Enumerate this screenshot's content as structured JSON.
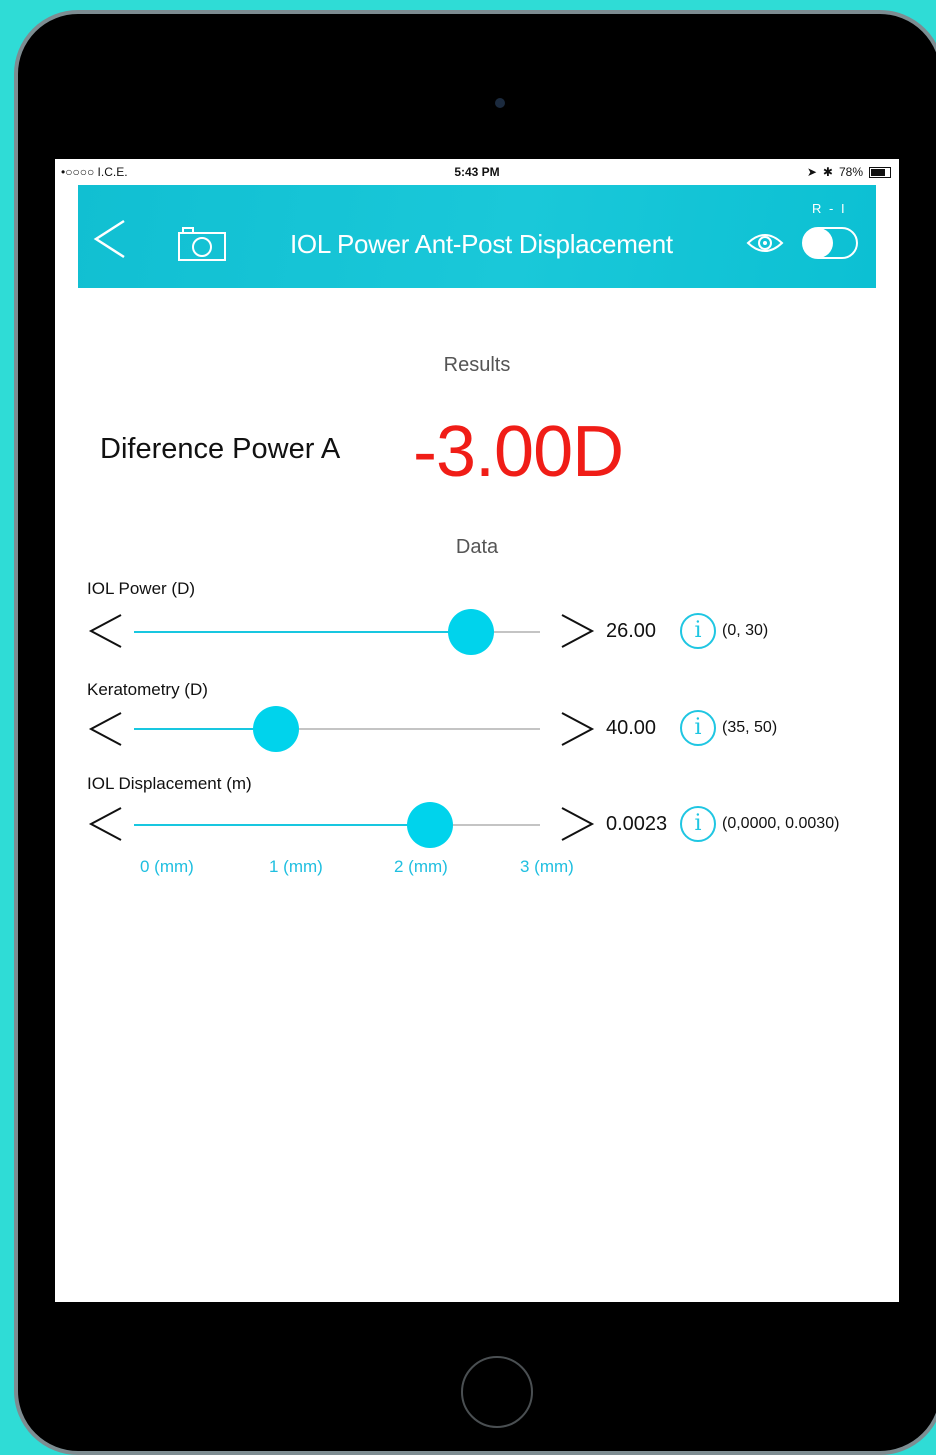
{
  "status_bar": {
    "carrier": "•○○○○ I.C.E.",
    "time": "5:43 PM",
    "battery": "78%"
  },
  "nav": {
    "title": "IOL Power Ant-Post Displacement",
    "toggle_caption": "R - I",
    "toggle_on": false
  },
  "results": {
    "heading": "Results",
    "label": "Diference Power A",
    "value": "-3.00D"
  },
  "data_section": {
    "heading": "Data",
    "sliders": [
      {
        "label": "IOL Power (D)",
        "value": "26.00",
        "range": "(0, 30)",
        "position": 0.83
      },
      {
        "label": "Keratometry (D)",
        "value": "40.00",
        "range": "(35, 50)",
        "position": 0.35
      },
      {
        "label": "IOL Displacement (m)",
        "value": "0.0023",
        "range": "(0,0000, 0.0030)",
        "position": 0.73
      }
    ],
    "ticks": [
      "0 (mm)",
      "1 (mm)",
      "2 (mm)",
      "3 (mm)"
    ],
    "info_glyph": "i"
  },
  "colors": {
    "accent": "#00d3ec",
    "result": "#f01d17",
    "nav": "#11bfd2"
  }
}
